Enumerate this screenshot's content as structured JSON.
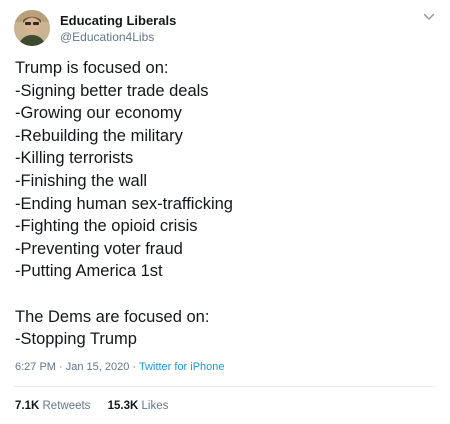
{
  "author": {
    "display_name": "Educating Liberals",
    "handle": "@Education4Libs",
    "avatar_icon": "profile-photo"
  },
  "menu_icon": "chevron-down-icon",
  "tweet": {
    "lines": [
      "Trump is focused on:",
      "-Signing better trade deals",
      "-Growing our economy",
      "-Rebuilding the military",
      "-Killing terrorists",
      "-Finishing the wall",
      "-Ending human sex-trafficking",
      "-Fighting the opioid crisis",
      "-Preventing voter fraud",
      "-Putting America 1st",
      "",
      "The Dems are focused on:",
      "-Stopping Trump"
    ]
  },
  "meta": {
    "timestamp": "6:27 PM · Jan 15, 2020 ·",
    "source": "Twitter for iPhone"
  },
  "stats": {
    "retweets_count": "7.1K",
    "retweets_label": "Retweets",
    "likes_count": "15.3K",
    "likes_label": "Likes"
  },
  "colors": {
    "text": "#14171a",
    "secondary": "#657786",
    "link": "#1b95e0",
    "divider": "#e6ecf0"
  }
}
